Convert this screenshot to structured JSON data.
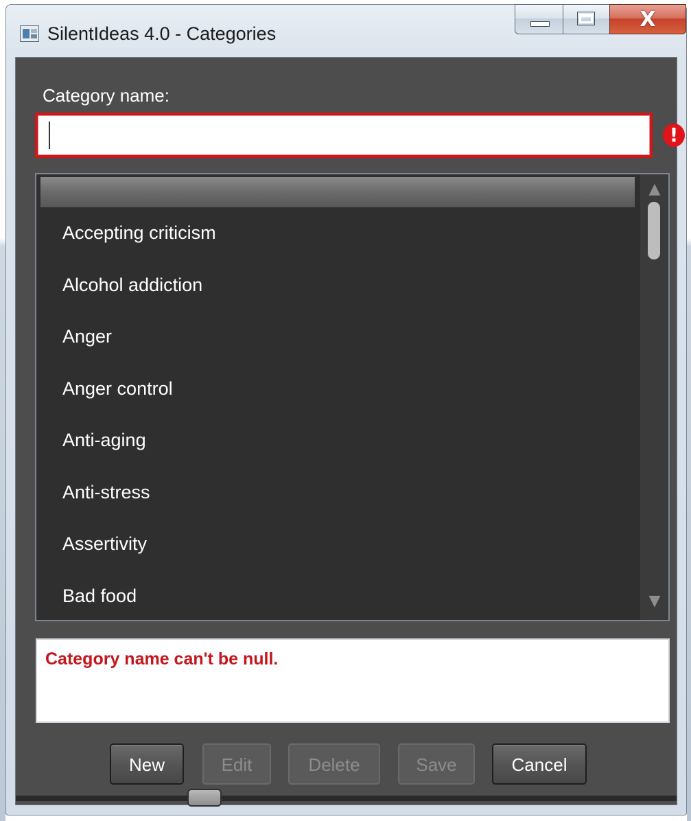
{
  "window": {
    "title": "SilentIdeas 4.0 - Categories",
    "close_symbol": "X"
  },
  "form": {
    "category_label": "Category name:",
    "category_value": "",
    "error_badge": "!"
  },
  "list": {
    "items": [
      "Accepting criticism",
      "Alcohol addiction",
      "Anger",
      "Anger control",
      "Anti-aging",
      "Anti-stress",
      "Assertivity",
      "Bad food"
    ],
    "scroll_up": "▲",
    "scroll_down": "▼"
  },
  "validation": {
    "message": "Category name can't be null."
  },
  "buttons": {
    "new": "New",
    "edit": "Edit",
    "delete": "Delete",
    "save": "Save",
    "cancel": "Cancel"
  },
  "colors": {
    "error_red": "#d0161b",
    "client_bg": "#4d4d4d",
    "list_bg": "#2f2f2f"
  }
}
